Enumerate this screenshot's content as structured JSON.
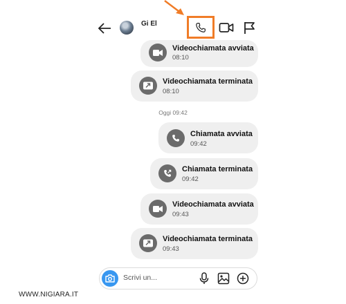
{
  "header": {
    "contact_name": "Gi El",
    "icons": {
      "back": "back-arrow-icon",
      "call": "phone-icon",
      "video": "video-camera-icon",
      "flag": "flag-icon"
    },
    "highlight_color": "#f07c27"
  },
  "messages": [
    {
      "title": "Videochiamata avviata",
      "time": "08:10",
      "icon": "video-camera-icon"
    },
    {
      "title": "Videochiamata terminata",
      "time": "08:10",
      "icon": "video-ended-icon"
    },
    {
      "title": "Chiamata avviata",
      "time": "09:42",
      "icon": "phone-icon"
    },
    {
      "title": "Chiamata terminata",
      "time": "09:42",
      "icon": "phone-ended-icon"
    },
    {
      "title": "Videochiamata avviata",
      "time": "09:43",
      "icon": "video-camera-icon"
    },
    {
      "title": "Videochiamata terminata",
      "time": "09:43",
      "icon": "video-ended-icon"
    }
  ],
  "divider_timestamp": "Oggi 09:42",
  "composer": {
    "placeholder": "Scrivi un...",
    "icons": [
      "camera-icon",
      "microphone-icon",
      "gallery-icon",
      "add-circle-icon"
    ],
    "camera_color": "#3897f0"
  },
  "watermark": "WWW.NIGIARA.IT"
}
